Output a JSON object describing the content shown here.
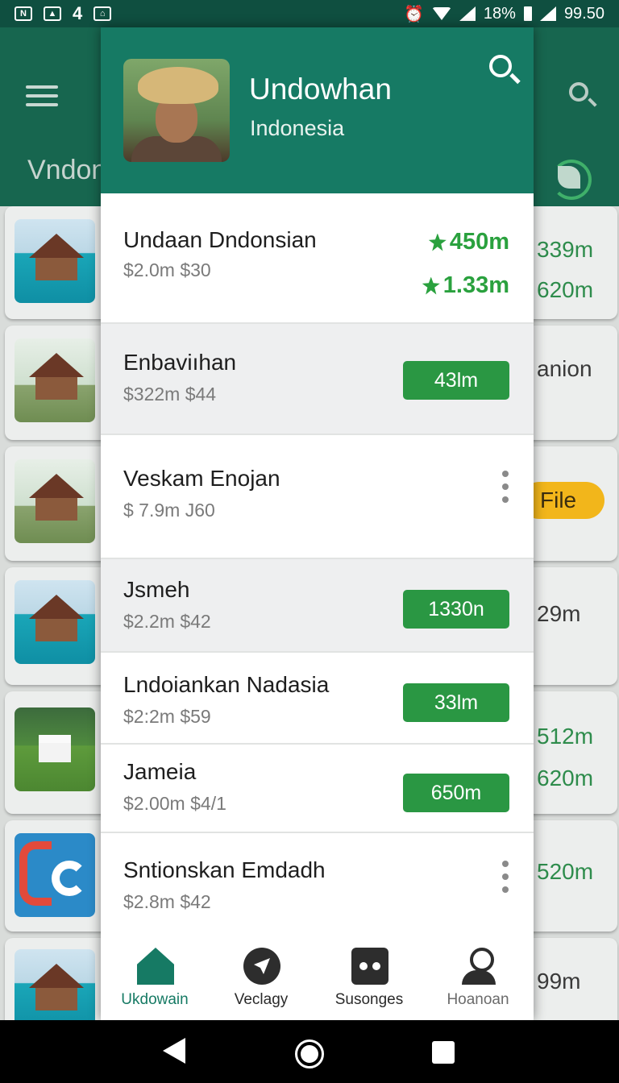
{
  "status_bar": {
    "left_text": "4",
    "battery_percent": "18%",
    "right_text": "99.50"
  },
  "background_app": {
    "title": "Vndon",
    "values": [
      "339m",
      "620m",
      "anion",
      "29m",
      "512m",
      "620m",
      "520m",
      "99m"
    ],
    "badge": "File"
  },
  "drawer": {
    "profile": {
      "name": "Undowhan",
      "location": "Indonesia"
    },
    "items": [
      {
        "title": "Undaan Dndonsian",
        "subtitle": "$2.0m $30",
        "values": [
          "450m",
          "1.33m"
        ]
      },
      {
        "title": "Enbaviıhan",
        "subtitle": "$322m $44",
        "pill": "43lm"
      },
      {
        "title": "Veskam Enojan",
        "subtitle": "$ 7.9m J60"
      },
      {
        "title": "Jsmeh",
        "subtitle": "$2.2m $42",
        "pill": "1330n"
      },
      {
        "title": "Lndoiankan Nadasia",
        "subtitle": "$2:2m $59",
        "pill": "33lm"
      },
      {
        "title": "Jameia",
        "subtitle": "$2.00m $4/1",
        "pill": "650m"
      },
      {
        "title": "Sntionskan Emdadh",
        "subtitle": "$2.8m $42"
      }
    ],
    "bottom_nav": [
      {
        "label": "Ukdowain",
        "icon": "home-icon"
      },
      {
        "label": "Veclagy",
        "icon": "compass-icon"
      },
      {
        "label": "Susonges",
        "icon": "songs-icon"
      },
      {
        "label": "Hoanoan",
        "icon": "person-icon"
      }
    ]
  },
  "colors": {
    "primary": "#167a64",
    "accent_green": "#2aa13e",
    "badge_yellow": "#f2b61b"
  }
}
